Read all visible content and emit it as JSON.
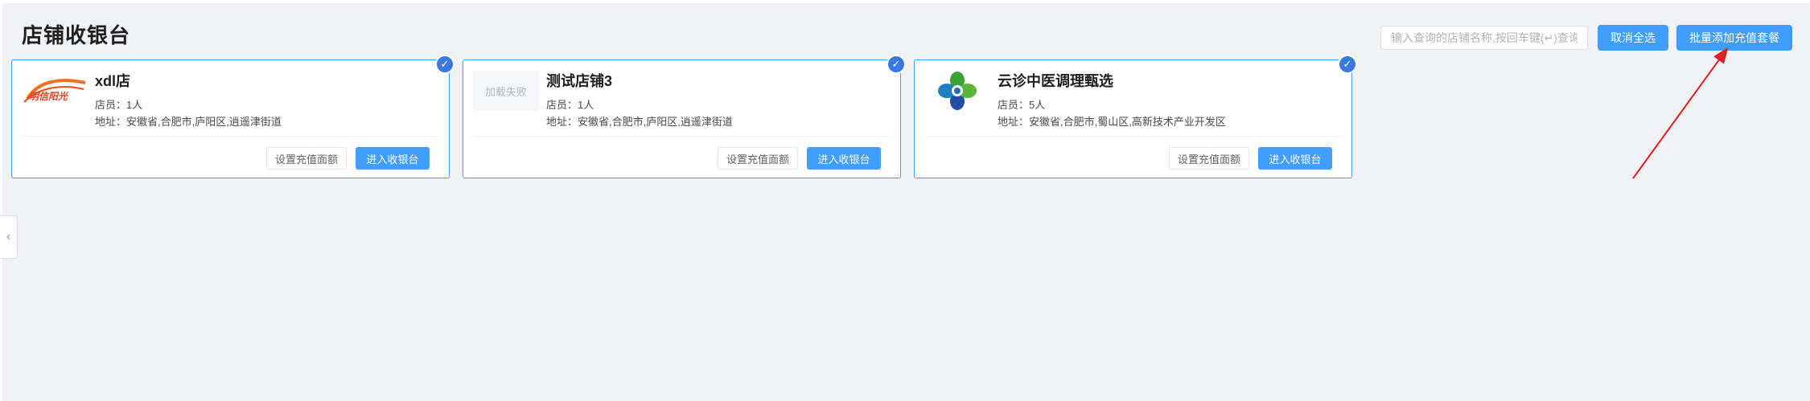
{
  "page": {
    "title": "店铺收银台"
  },
  "toolbar": {
    "search_placeholder": "输入查询的店铺名称,按回车键(↵)查询",
    "cancel_select_all": "取消全选",
    "batch_add_package": "批量添加充值套餐"
  },
  "stores": [
    {
      "name": "xdl店",
      "staff": "店员：1人",
      "address": "地址：安徽省,合肥市,庐阳区,逍遥津街道",
      "logo": {
        "type": "brand-image",
        "text": "明信阳光"
      },
      "checked": true,
      "set_button": "设置充值面额",
      "enter_button": "进入收银台"
    },
    {
      "name": "测试店铺3",
      "staff": "店员：1人",
      "address": "地址：安徽省,合肥市,庐阳区,逍遥津街道",
      "logo": {
        "type": "failed",
        "text": "加载失败"
      },
      "checked": true,
      "set_button": "设置充值面额",
      "enter_button": "进入收银台"
    },
    {
      "name": "云诊中医调理甄选",
      "staff": "店员：5人",
      "address": "地址：安徽省,合肥市,蜀山区,高新技术产业开发区",
      "logo": {
        "type": "brand-image"
      },
      "checked": true,
      "set_button": "设置充值面额",
      "enter_button": "进入收银台"
    }
  ],
  "icons": {
    "check": "checkmark-icon",
    "collapse": "chevron-left-icon",
    "annotation": "red-arrow-annotation"
  },
  "colors": {
    "primary": "#409eff",
    "check_badge": "#3a79e0",
    "annotation_arrow": "#e02020",
    "background": "#f0f2f5"
  }
}
